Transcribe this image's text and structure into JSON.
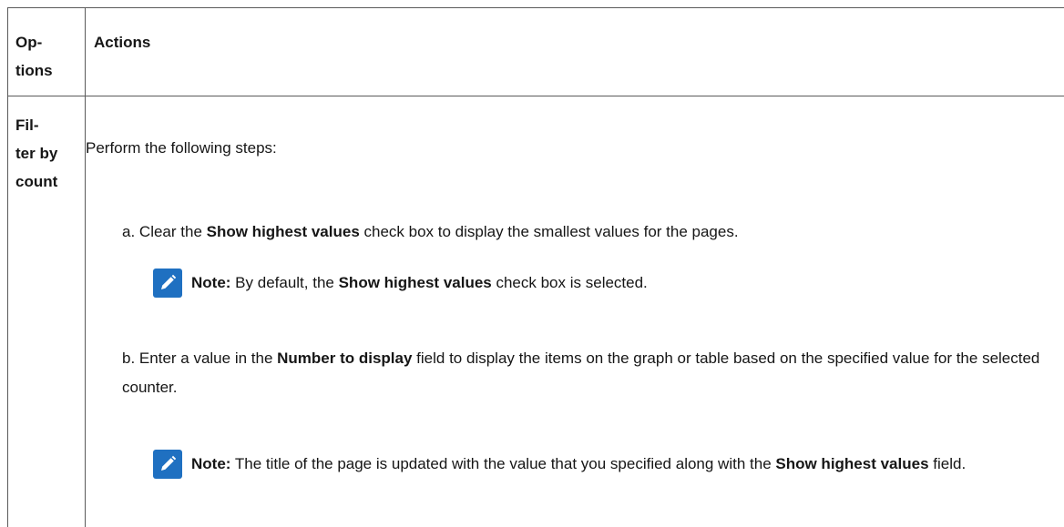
{
  "table": {
    "header": {
      "options": "Op-\ntions",
      "actions": "Actions"
    },
    "row": {
      "option": "Fil-\nter by\ncount",
      "intro": "Perform the following steps:",
      "steps": [
        {
          "marker": "a.",
          "parts": [
            "Clear the ",
            "Show highest values",
            " check box to display the smallest values for the pages."
          ],
          "note": {
            "label": "Note:",
            "parts": [
              " By default, the ",
              "Show highest values",
              " check box is selected."
            ]
          }
        },
        {
          "marker": "b.",
          "parts": [
            "Enter a value in the ",
            "Number to display",
            " field to display the items on the graph or table based on the specified value for the selected counter."
          ],
          "note": {
            "label": "Note:",
            "parts": [
              " The title of the page is updated with the value that you specified along with the ",
              "Show highest values",
              " field."
            ]
          }
        }
      ]
    }
  },
  "colors": {
    "note_icon_bg": "#1f70c1",
    "border": "#5a5a5a",
    "text": "#161616"
  },
  "icons": {
    "note": "pencil-note-icon"
  }
}
